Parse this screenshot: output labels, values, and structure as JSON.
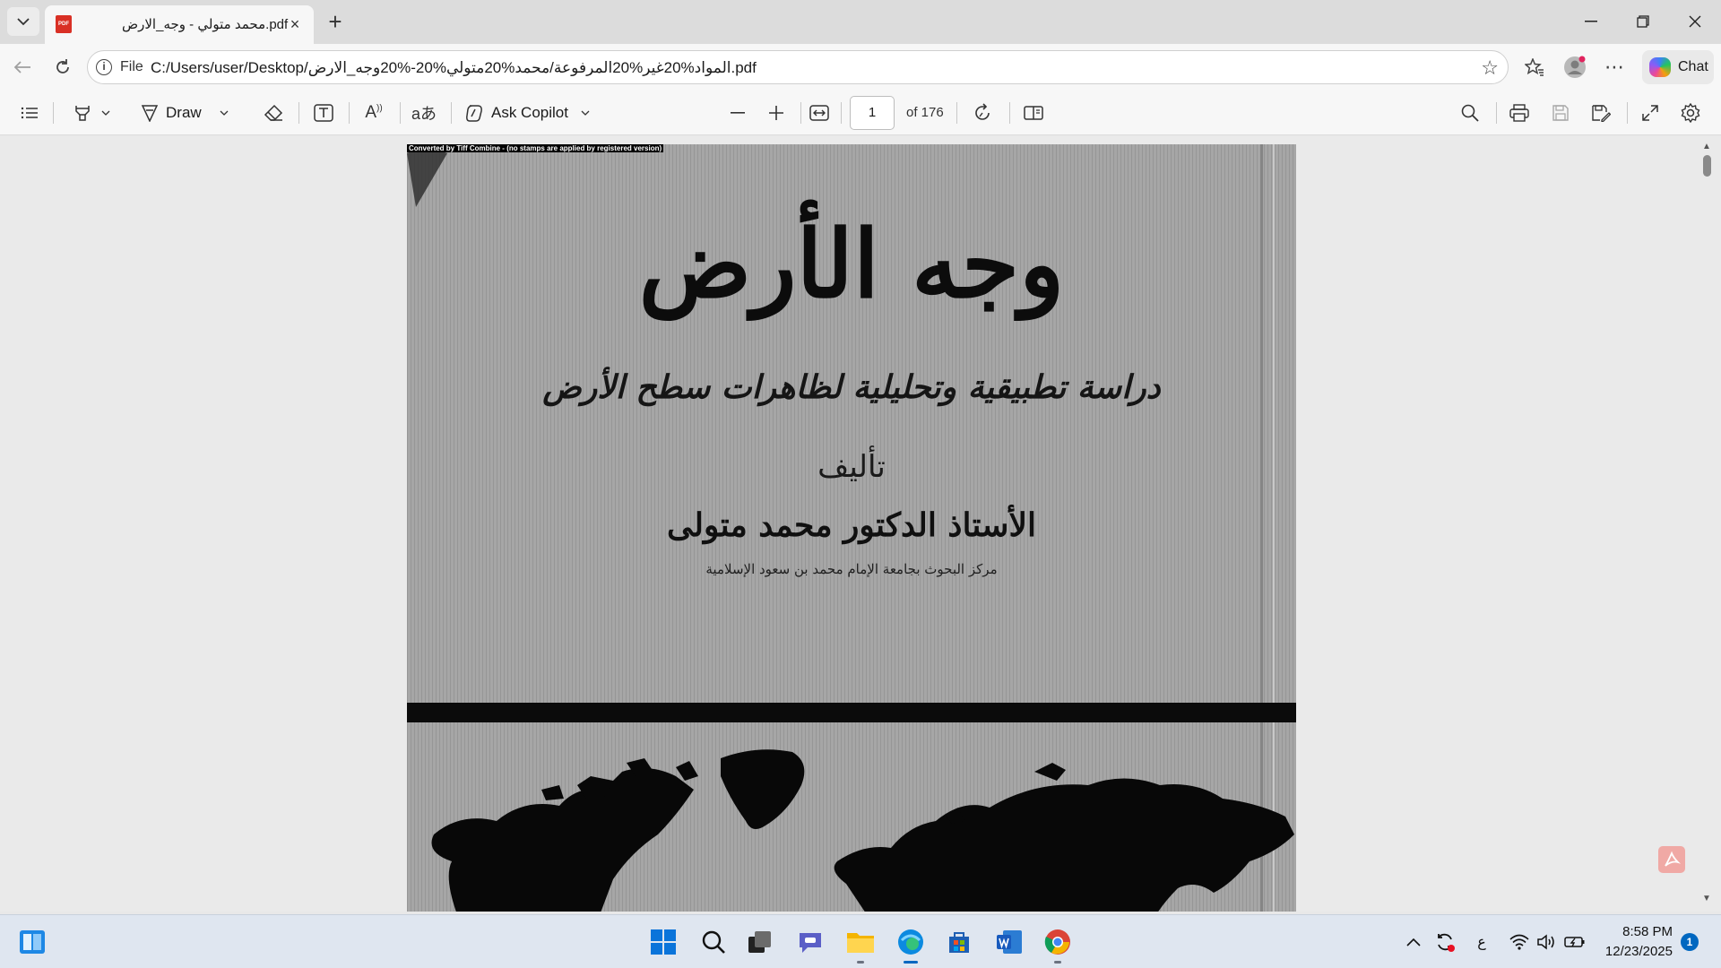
{
  "tab": {
    "title": "محمد متولي - وجه_الارض.pdf"
  },
  "address_bar": {
    "scheme_label": "File",
    "url": "C:/Users/user/Desktop/المواد%20غير%20المرفوعة/محمد%20متولي%20-%20وجه_الارض.pdf"
  },
  "chat_label": "Chat",
  "pdf_toolbar": {
    "draw_label": "Draw",
    "copilot_label": "Ask Copilot",
    "page_number": "1",
    "page_total": "of 176"
  },
  "document": {
    "banner": "Converted by Tiff Combine - (no stamps are applied by registered version)",
    "title": "وجه الأرض",
    "subtitle": "دراسة تطبيقية وتحليلية لظاهرات سطح الأرض",
    "authored_by": "تأليف",
    "author": "الأستاذ الدكتور محمد متولى",
    "affiliation": "مركز البحوث بجامعة الإمام محمد بن سعود الإسلامية"
  },
  "taskbar": {
    "clock": "8:58 PM",
    "date": "12/23/2025",
    "lang": "ع",
    "notifications": "1"
  },
  "colors": {
    "accent": "#0067c0",
    "pdf_red": "#d93025"
  }
}
